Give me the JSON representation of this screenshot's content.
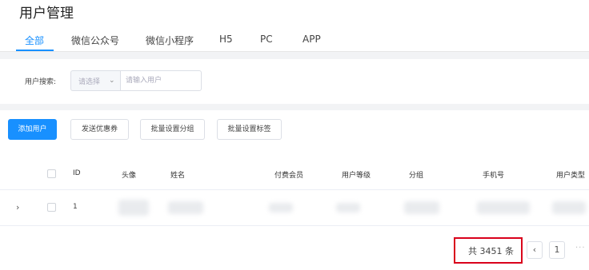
{
  "page": {
    "title": "用户管理"
  },
  "tabs": [
    {
      "label": "全部",
      "active": true
    },
    {
      "label": "微信公众号"
    },
    {
      "label": "微信小程序"
    },
    {
      "label": "H5"
    },
    {
      "label": "PC"
    },
    {
      "label": "APP"
    }
  ],
  "search": {
    "label": "用户搜索:",
    "select_placeholder": "请选择",
    "input_placeholder": "请输入用户"
  },
  "toolbar": {
    "add_user": "添加用户",
    "send_coupon": "发送优惠券",
    "batch_group": "批量设置分组",
    "batch_tag": "批量设置标签"
  },
  "table": {
    "columns": [
      "ID",
      "头像",
      "姓名",
      "付费会员",
      "用户等级",
      "分组",
      "手机号",
      "用户类型"
    ],
    "rows": [
      {
        "id": "1"
      }
    ]
  },
  "pagination": {
    "total_text": "共 3451 条",
    "prev": "‹",
    "current_page": "1",
    "more": "···"
  },
  "colors": {
    "accent": "#1890ff",
    "highlight_border": "#d9001b"
  }
}
